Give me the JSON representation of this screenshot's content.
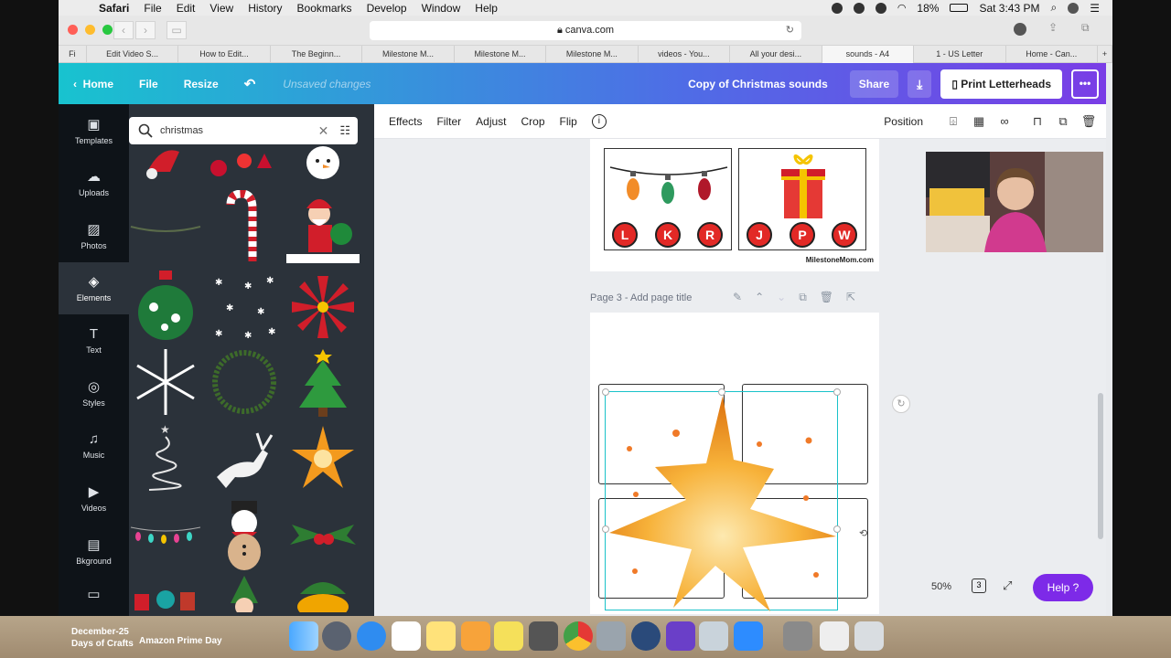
{
  "menubar": {
    "app": "Safari",
    "items": [
      "File",
      "Edit",
      "View",
      "History",
      "Bookmarks",
      "Develop",
      "Window",
      "Help"
    ],
    "battery": "18%",
    "clock": "Sat 3:43 PM"
  },
  "browser": {
    "url": "canva.com",
    "tabs": [
      "Fi",
      "Edit Video S...",
      "How to Edit...",
      "The Beginn...",
      "Milestone M...",
      "Milestone M...",
      "Milestone M...",
      "videos - You...",
      "All your desi...",
      "sounds - A4",
      "1 - US Letter",
      "Home - Can..."
    ],
    "active_tab_index": 9
  },
  "header": {
    "home": "Home",
    "file": "File",
    "resize": "Resize",
    "undo_icon": "undo-icon",
    "unsaved": "Unsaved changes",
    "doc_title": "Copy of Christmas sounds",
    "share": "Share",
    "print": "Print Letterheads",
    "more": "•••"
  },
  "rail": {
    "items": [
      {
        "label": "Templates",
        "icon": "templates-icon",
        "glyph": "▣"
      },
      {
        "label": "Uploads",
        "icon": "upload-icon",
        "glyph": "☁"
      },
      {
        "label": "Photos",
        "icon": "photo-icon",
        "glyph": "▨"
      },
      {
        "label": "Elements",
        "icon": "elements-icon",
        "glyph": "◈"
      },
      {
        "label": "Text",
        "icon": "text-icon",
        "glyph": "T"
      },
      {
        "label": "Styles",
        "icon": "styles-icon",
        "glyph": "◎"
      },
      {
        "label": "Music",
        "icon": "music-icon",
        "glyph": "♫"
      },
      {
        "label": "Videos",
        "icon": "video-icon",
        "glyph": "▶"
      },
      {
        "label": "Bkground",
        "icon": "background-icon",
        "glyph": "▤"
      }
    ],
    "active_index": 3
  },
  "panel": {
    "search_value": "christmas"
  },
  "toolbar": {
    "effects": "Effects",
    "filter": "Filter",
    "adjust": "Adjust",
    "crop": "Crop",
    "flip": "Flip",
    "position": "Position"
  },
  "canvas": {
    "page2_letters_left": [
      "L",
      "K",
      "R"
    ],
    "page2_letters_right": [
      "J",
      "P",
      "W"
    ],
    "watermark": "MilestoneMom.com",
    "page3_label": "Page 3 - Add page title"
  },
  "footer": {
    "zoom": "50%",
    "page_count": "3",
    "help": "Help ?"
  },
  "dock": {
    "left_text_1": "December-25",
    "left_text_2": "Days of Crafts",
    "left_text_3": "Amazon Prime Day"
  }
}
